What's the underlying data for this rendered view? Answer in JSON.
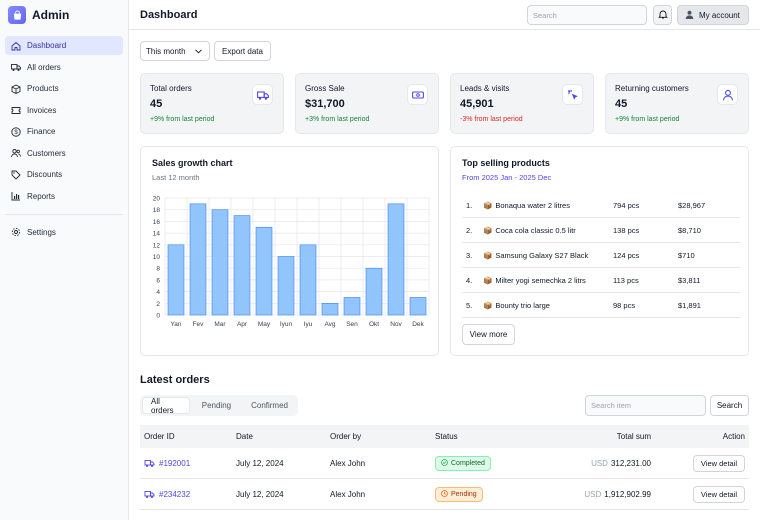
{
  "app": {
    "title": "Admin"
  },
  "sidebar": {
    "items": [
      {
        "label": "Dashboard",
        "icon": "home-icon",
        "active": true
      },
      {
        "label": "All orders",
        "icon": "truck-icon"
      },
      {
        "label": "Products",
        "icon": "box-icon"
      },
      {
        "label": "Invoices",
        "icon": "ticket-icon"
      },
      {
        "label": "Finance",
        "icon": "dollar-circle-icon"
      },
      {
        "label": "Customers",
        "icon": "users-icon"
      },
      {
        "label": "Discounts",
        "icon": "tag-icon"
      },
      {
        "label": "Reports",
        "icon": "bar-chart-icon"
      }
    ],
    "settings_label": "Settings"
  },
  "header": {
    "title": "Dashboard",
    "search_placeholder": "Search",
    "account_label": "My account"
  },
  "toolbar": {
    "period": "This month",
    "export_label": "Export data"
  },
  "stats": [
    {
      "label": "Total orders",
      "value": "45",
      "delta": "+9% from last period",
      "trend": "up",
      "icon": "truck-icon"
    },
    {
      "label": "Gross Sale",
      "value": "$31,700",
      "delta": "+3% from last period",
      "trend": "up",
      "icon": "banknote-icon"
    },
    {
      "label": "Leads & visits",
      "value": "45,901",
      "delta": "-3% from last period",
      "trend": "down",
      "icon": "cursor-click-icon"
    },
    {
      "label": "Returning customers",
      "value": "45",
      "delta": "+9% from last period",
      "trend": "up",
      "icon": "user-icon"
    }
  ],
  "colors": {
    "accent": "#4f46e5",
    "up": "#15803d",
    "down": "#dc2626",
    "bar_fill": "#93c5fd",
    "bar_stroke": "#3b82f6"
  },
  "sales_chart": {
    "title": "Sales growth chart",
    "subtitle": "Last 12 month"
  },
  "chart_data": {
    "type": "bar",
    "categories": [
      "Yan",
      "Fev",
      "Mar",
      "Apr",
      "May",
      "Iyun",
      "Iyu",
      "Avg",
      "Sen",
      "Okt",
      "Nov",
      "Dek"
    ],
    "values": [
      12,
      19,
      18,
      17,
      15,
      10,
      12,
      2,
      3,
      8,
      19,
      3
    ],
    "ylim": [
      0,
      20
    ],
    "yticks": [
      0,
      2,
      4,
      6,
      8,
      10,
      12,
      14,
      16,
      18,
      20
    ],
    "grid": true
  },
  "top_products": {
    "title": "Top selling products",
    "subtitle": "From 2025 Jan - 2025 Dec",
    "rows": [
      {
        "rank": "1.",
        "name": "Bonaqua water 2 litres",
        "qty": "794 pcs",
        "amount": "$28,967"
      },
      {
        "rank": "2.",
        "name": "Coca cola classic 0.5 litr",
        "qty": "138 pcs",
        "amount": "$8,710"
      },
      {
        "rank": "3.",
        "name": "Samsung Galaxy S27 Black",
        "qty": "124 pcs",
        "amount": "$710"
      },
      {
        "rank": "4.",
        "name": "Milter yogi semechka 2 litrs",
        "qty": "113 pcs",
        "amount": "$3,811"
      },
      {
        "rank": "5.",
        "name": "Bounty trio large",
        "qty": "98 pcs",
        "amount": "$1,891"
      }
    ],
    "view_more_label": "View more"
  },
  "orders": {
    "title": "Latest orders",
    "tabs": [
      "All orders",
      "Pending",
      "Confirmed"
    ],
    "search_placeholder": "Search item",
    "search_button": "Search",
    "columns": {
      "id": "Order ID",
      "date": "Date",
      "by": "Order by",
      "status": "Status",
      "total": "Total sum",
      "action": "Action"
    },
    "rows": [
      {
        "id": "#192001",
        "date": "July 12, 2024",
        "by": "Alex John",
        "status": "Completed",
        "currency": "USD",
        "total": "312,231.00",
        "action": "View detail"
      },
      {
        "id": "#234232",
        "date": "July 12, 2024",
        "by": "Alex John",
        "status": "Pending",
        "currency": "USD",
        "total": "1,912,902.99",
        "action": "View detail"
      }
    ]
  }
}
